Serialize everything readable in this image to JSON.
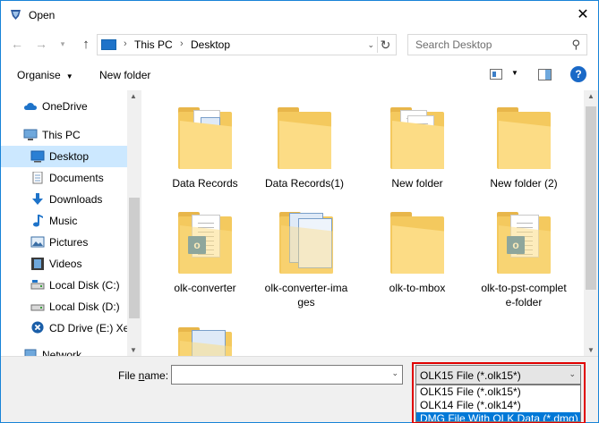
{
  "window": {
    "title": "Open",
    "close_glyph": "✕"
  },
  "nav": {
    "back_glyph": "←",
    "forward_glyph": "→",
    "recent_glyph": "▾",
    "up_glyph": "↑"
  },
  "address": {
    "crumbs": [
      "This PC",
      "Desktop"
    ],
    "separator": "›",
    "dropdown_glyph": "⌄",
    "refresh_glyph": "↻"
  },
  "search": {
    "placeholder": "Search Desktop",
    "icon_glyph": "⚲"
  },
  "toolbar": {
    "organise_label": "Organise",
    "organise_caret": "▼",
    "new_folder_label": "New folder",
    "view_caret": "▼",
    "help_label": "?"
  },
  "sidebar": {
    "items": [
      {
        "label": "OneDrive",
        "icon": "cloud-icon"
      },
      {
        "label": "This PC",
        "icon": "computer-icon"
      },
      {
        "label": "Desktop",
        "icon": "desktop-icon",
        "selected": true
      },
      {
        "label": "Documents",
        "icon": "documents-icon"
      },
      {
        "label": "Downloads",
        "icon": "download-arrow-icon"
      },
      {
        "label": "Music",
        "icon": "music-note-icon"
      },
      {
        "label": "Pictures",
        "icon": "pictures-icon"
      },
      {
        "label": "Videos",
        "icon": "film-icon"
      },
      {
        "label": "Local Disk (C:)",
        "icon": "drive-icon"
      },
      {
        "label": "Local Disk (D:)",
        "icon": "drive-icon"
      },
      {
        "label": "CD Drive (E:) Xer",
        "icon": "cd-drive-icon"
      },
      {
        "label": "Network",
        "icon": "network-icon"
      }
    ]
  },
  "files": [
    {
      "name": "Data Records",
      "kind": "folder-docs"
    },
    {
      "name": "Data Records(1)",
      "kind": "folder"
    },
    {
      "name": "New folder",
      "kind": "folder-docs"
    },
    {
      "name": "New folder (2)",
      "kind": "folder"
    },
    {
      "name": "olk-converter",
      "kind": "folder-olk"
    },
    {
      "name": "olk-converter-images",
      "kind": "folder-screens"
    },
    {
      "name": "olk-to-mbox",
      "kind": "folder"
    },
    {
      "name": "olk-to-pst-complete-folder",
      "kind": "folder-olk"
    },
    {
      "name": "",
      "kind": "folder-screens"
    }
  ],
  "olk_badge_letter": "o",
  "bottom": {
    "file_name_label_prefix": "File ",
    "file_name_label_underlined": "n",
    "file_name_label_suffix": "ame:",
    "file_name_value": "",
    "file_type_selected": "OLK15 File (*.olk15*)",
    "dropdown_glyph": "⌄",
    "file_type_options": [
      "OLK15 File (*.olk15*)",
      "OLK14 File (*.olk14*)",
      "DMG File With OLK Data (*.dmg)"
    ],
    "highlighted_option_index": 2
  },
  "scroll_glyphs": {
    "up": "▲",
    "down": "▼"
  },
  "colors": {
    "accent": "#0078d7",
    "selection": "#cce8ff",
    "highlight_border": "#e00000",
    "folder": "#f4c95e"
  }
}
